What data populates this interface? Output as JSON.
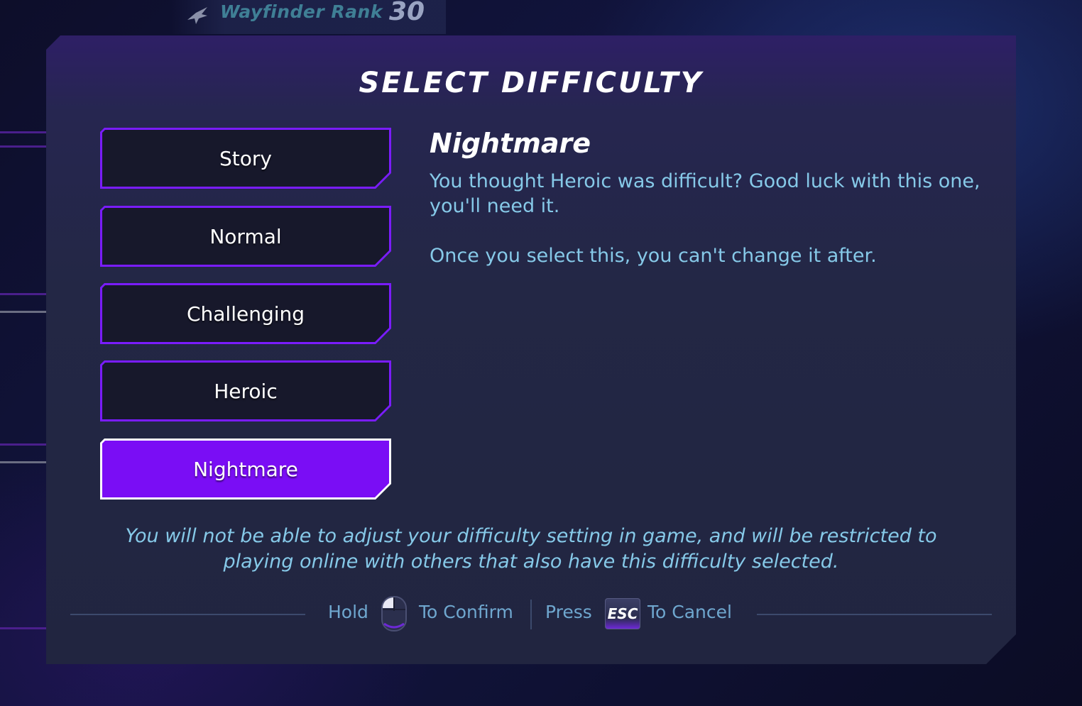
{
  "header": {
    "rank_label": "Wayfinder Rank",
    "rank_value": "30",
    "rank_icon": "bird-emblem-icon"
  },
  "dialog": {
    "title": "SELECT DIFFICULTY",
    "options": [
      {
        "label": "Story",
        "selected": false
      },
      {
        "label": "Normal",
        "selected": false
      },
      {
        "label": "Challenging",
        "selected": false
      },
      {
        "label": "Heroic",
        "selected": false
      },
      {
        "label": "Nightmare",
        "selected": true
      }
    ],
    "detail": {
      "title": "Nightmare",
      "description": "You thought Heroic was difficult? Good luck with this one, you'll need it.",
      "note": "Once you select this, you can't change it after."
    },
    "warning": "You will not be able to adjust your difficulty setting in game, and will be restricted to playing online with others that also have this difficulty selected."
  },
  "footer": {
    "hold": "Hold",
    "confirm": "To Confirm",
    "confirm_icon": "mouse-left-click-icon",
    "press": "Press",
    "esc_key": "ESC",
    "cancel": "To Cancel"
  },
  "colors": {
    "accent": "#7a0df5",
    "accent_border": "#7a1cff",
    "text_cyan": "#86c9e8",
    "prompt": "#6fa7cf",
    "panel": "#232745"
  }
}
